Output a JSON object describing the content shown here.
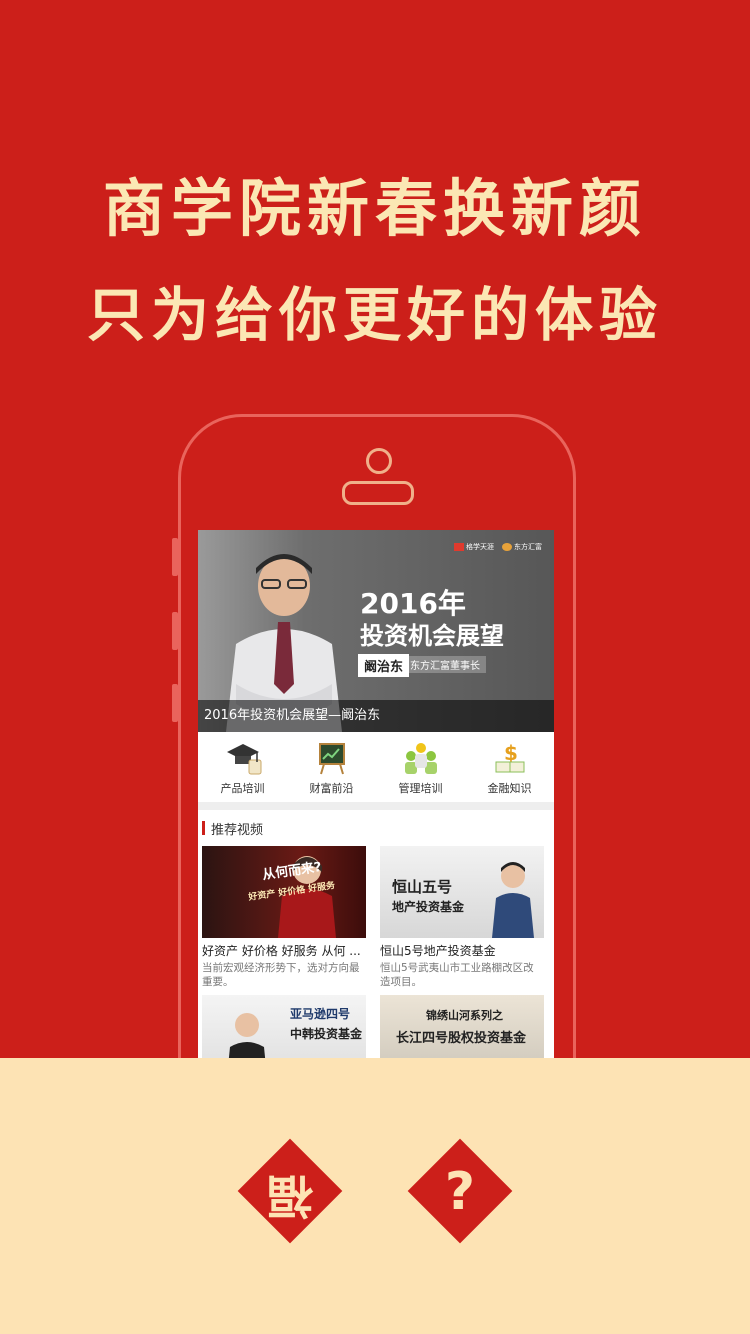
{
  "promo": {
    "headline": "商学院新春换新颜",
    "subheadline": "只为给你更好的体验"
  },
  "banner": {
    "logo_left": "格学天涯",
    "logo_right": "东方汇富",
    "year": "2016年",
    "title": "投资机会展望",
    "speaker_name": "阚治东",
    "speaker_role": "东方汇富董事长",
    "caption": "2016年投资机会展望—阚治东"
  },
  "categories": [
    {
      "label": "产品培训",
      "icon": "graduation-cap-icon"
    },
    {
      "label": "财富前沿",
      "icon": "chart-board-icon"
    },
    {
      "label": "管理培训",
      "icon": "people-group-icon"
    },
    {
      "label": "金融知识",
      "icon": "dollar-book-icon"
    }
  ],
  "recommended": {
    "title": "推荐视频",
    "items": [
      {
        "thumb_text": "从何而来?",
        "thumb_sub": "好资产 好价格 好服务",
        "title": "好资产 好价格 好服务 从何 ...",
        "desc": "当前宏观经济形势下，选对方向最重要。"
      },
      {
        "thumb_text": "恒山五号",
        "thumb_sub": "地产投资基金",
        "title": "恒山5号地产投资基金",
        "desc": "恒山5号武夷山市工业路棚改区改造项目。"
      },
      {
        "thumb_text": "亚马逊四号",
        "thumb_sub": "中韩投资基金",
        "title": "",
        "desc": ""
      },
      {
        "thumb_text": "锦绣山河系列之",
        "thumb_sub": "长江四号股权投资基金",
        "title": "",
        "desc": ""
      }
    ]
  },
  "footer": {
    "fu_char": "福",
    "help_char": "?"
  },
  "colors": {
    "brand_red": "#cc1f1a",
    "cream": "#fde3b4"
  }
}
